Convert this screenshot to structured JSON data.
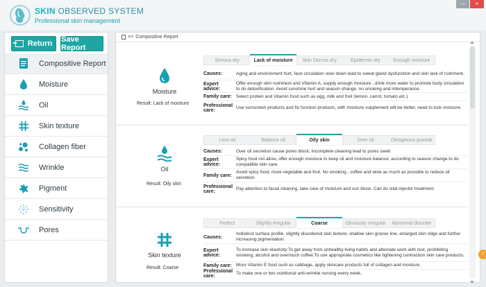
{
  "app": {
    "title_part1": "SKIN",
    "title_part2": "OBSERVED SYSTEM",
    "subtitle": "Professional skin management"
  },
  "window": {
    "minimize": "—",
    "close": "×"
  },
  "toolbar": {
    "return_label": "Return",
    "save_label": "Save Report"
  },
  "sidebar": {
    "items": [
      {
        "label": "Compositive Report",
        "icon": "report-icon"
      },
      {
        "label": "Moisture",
        "icon": "drop-icon"
      },
      {
        "label": "Oil",
        "icon": "oil-icon"
      },
      {
        "label": "Skin texture",
        "icon": "hash-icon"
      },
      {
        "label": "Collagen fiber",
        "icon": "collagen-icon"
      },
      {
        "label": "Wrinkle",
        "icon": "wrinkle-icon"
      },
      {
        "label": "Pigment",
        "icon": "pigment-icon"
      },
      {
        "label": "Sensitivity",
        "icon": "sensitivity-icon"
      },
      {
        "label": "Pores",
        "icon": "pores-icon"
      }
    ]
  },
  "breadcrumb": {
    "text": "Compositive Report",
    "sep": ">>"
  },
  "colors": {
    "accent": "#1ca7a3",
    "icon": "#1a9fb0",
    "close": "#e44b4b"
  },
  "sections": [
    {
      "name": "Moisture",
      "result": "Result: Lack of moisture",
      "tabs": [
        "Serious dry",
        "Lack of moisture",
        "Skin Dermis dry",
        "Epidermis dry",
        "Enough moisture"
      ],
      "selected": 1,
      "rows": [
        {
          "label": "Causes:",
          "text": "Aging and environment hurt, face circulation slow down lead to sweat gland dysfunction and skin lack of nutriment."
        },
        {
          "label": "Expert advice:",
          "text": "Offer enough skin nutriment and Vitamin A, supply enough moisture , drink more water to promote body circulation to do detoxification. Avoid sunshine hurt and season change, no smoking and intemperance."
        },
        {
          "label": "Family care:",
          "text": "Select protein and Vitamin food such as egg, milk and fruit (lemon, carrot, tomato etc.)"
        },
        {
          "label": "Professional care:",
          "text": "Use sunscreen products and fix function products, with moisture supplement will be better, need to lock moisture."
        }
      ]
    },
    {
      "name": "Oil",
      "result": "Result: Oily skin",
      "tabs": [
        "Less oil",
        "Balance oil",
        "Oily skin",
        "Over oil",
        "Oleaginous pustule"
      ],
      "selected": 2,
      "rows": [
        {
          "label": "Causes:",
          "text": "Over oil secretion cause pores block, Incomplete cleaning lead to pores swell."
        },
        {
          "label": "Expert advice:",
          "text": "Spicy food not allow, offer enough moisture to keep oil and moisture balance; according to season change to do compatible skin care."
        },
        {
          "label": "Family care:",
          "text": "Avoid spicy food, more vegetable and fruit. No smoking , coffee and wine as much as possible to reduce oil secretion."
        },
        {
          "label": "Professional care:",
          "text": "Pay attention to facial cleaning, take care of moisture and sun block. Can do vital injector treatment."
        }
      ]
    },
    {
      "name": "Skin texture",
      "result": "Result: Coarse",
      "tabs": [
        "Perfect",
        "Slightly irregular",
        "Coarse",
        "Obviously irregular",
        "Abnormal disorder"
      ],
      "selected": 2,
      "rows": [
        {
          "label": "Causes:",
          "text": "Indistinct surface profile, slightly disordered skin texture, shallow skin groove line, enlarged skin ridge and further increasing pigmentation."
        },
        {
          "label": "Expert advice:",
          "text": "To increase skin elasticity;To get away from unhealthy living habits and alternate work with rest, prohibiting smoking, alcohol and overmuch coffee;To use appropriate cosmetics like tightening contraction skin care products."
        },
        {
          "label": "Family care:",
          "text": "More Vitamin E food such as cabbage, apply skincare products full of collagen and moisture."
        },
        {
          "label": "Professional care:",
          "text": "To make one or two nutritional anti-wrinkle nursing every week."
        }
      ]
    }
  ],
  "floating_badge": "7"
}
